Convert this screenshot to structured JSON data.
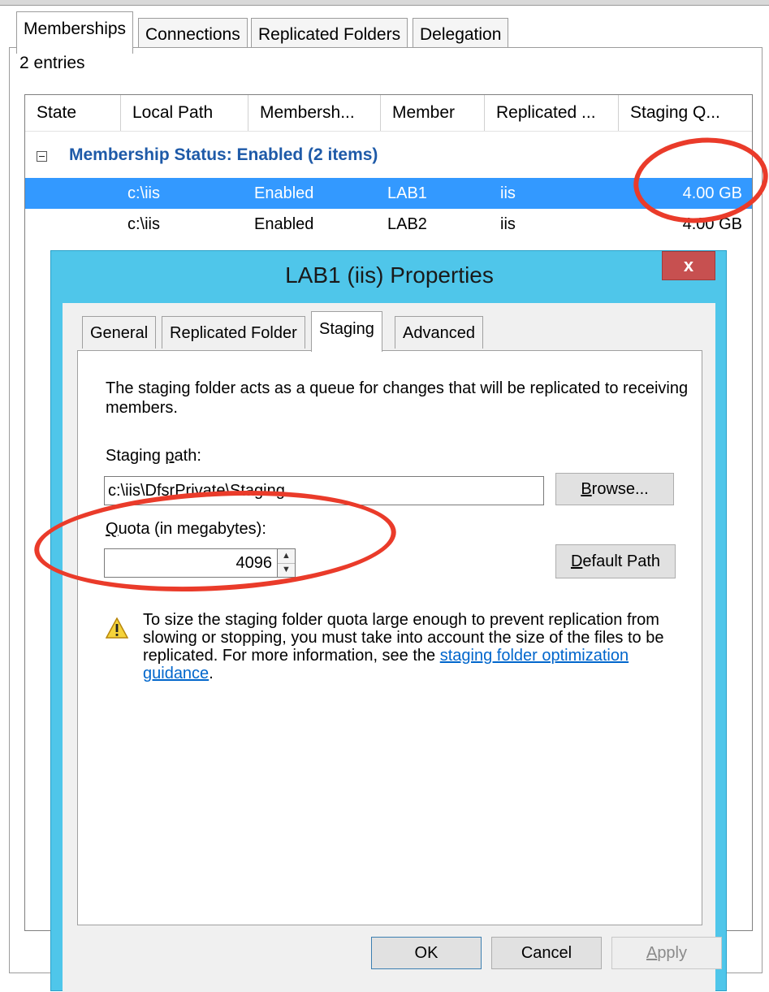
{
  "outer_tabs": [
    "Memberships",
    "Connections",
    "Replicated Folders",
    "Delegation"
  ],
  "entries_label": "2 entries",
  "columns": [
    "State",
    "Local Path",
    "Membersh...",
    "Member",
    "Replicated ...",
    "Staging Q..."
  ],
  "group": {
    "label": "Membership Status: Enabled (2 items)"
  },
  "rows": [
    {
      "local_path": "c:\\iis",
      "membership": "Enabled",
      "member": "LAB1",
      "replicated": "iis",
      "staging": "4.00 GB",
      "selected": true
    },
    {
      "local_path": "c:\\iis",
      "membership": "Enabled",
      "member": "LAB2",
      "replicated": "iis",
      "staging": "4.00 GB",
      "selected": false
    }
  ],
  "dialog": {
    "title": "LAB1 (iis) Properties",
    "close": "x",
    "tabs": [
      "General",
      "Replicated Folder",
      "Staging",
      "Advanced"
    ],
    "active_tab": "Staging",
    "description": "The staging folder acts as a queue for changes that will be replicated to receiving members.",
    "staging_path_label_pre": "Staging ",
    "staging_path_label_key": "p",
    "staging_path_label_post": "ath:",
    "staging_path_value": "c:\\iis\\DfsrPrivate\\Staging",
    "browse_key": "B",
    "browse_rest": "rowse...",
    "quota_label_key": "Q",
    "quota_label_rest": "uota (in megabytes):",
    "quota_value": "4096",
    "default_path_key": "D",
    "default_path_rest": "efault Path",
    "warning_text": "To size the staging folder quota large enough to prevent replication from slowing or stopping, you must take into account the size of the files to be replicated. For more information, see the",
    "warning_link": "staging folder optimization guidance",
    "warning_end": ".",
    "ok": "OK",
    "cancel": "Cancel",
    "apply_key": "A",
    "apply_rest": "pply"
  },
  "colors": {
    "selection": "#3399ff",
    "dialog_frame": "#4fc6ea",
    "close": "#c75050",
    "highlight": "#ea3b2a",
    "group_text": "#1e5aa8"
  },
  "icons": [
    "expander-minus-icon",
    "warning-icon",
    "spin-up-icon",
    "spin-down-icon"
  ]
}
